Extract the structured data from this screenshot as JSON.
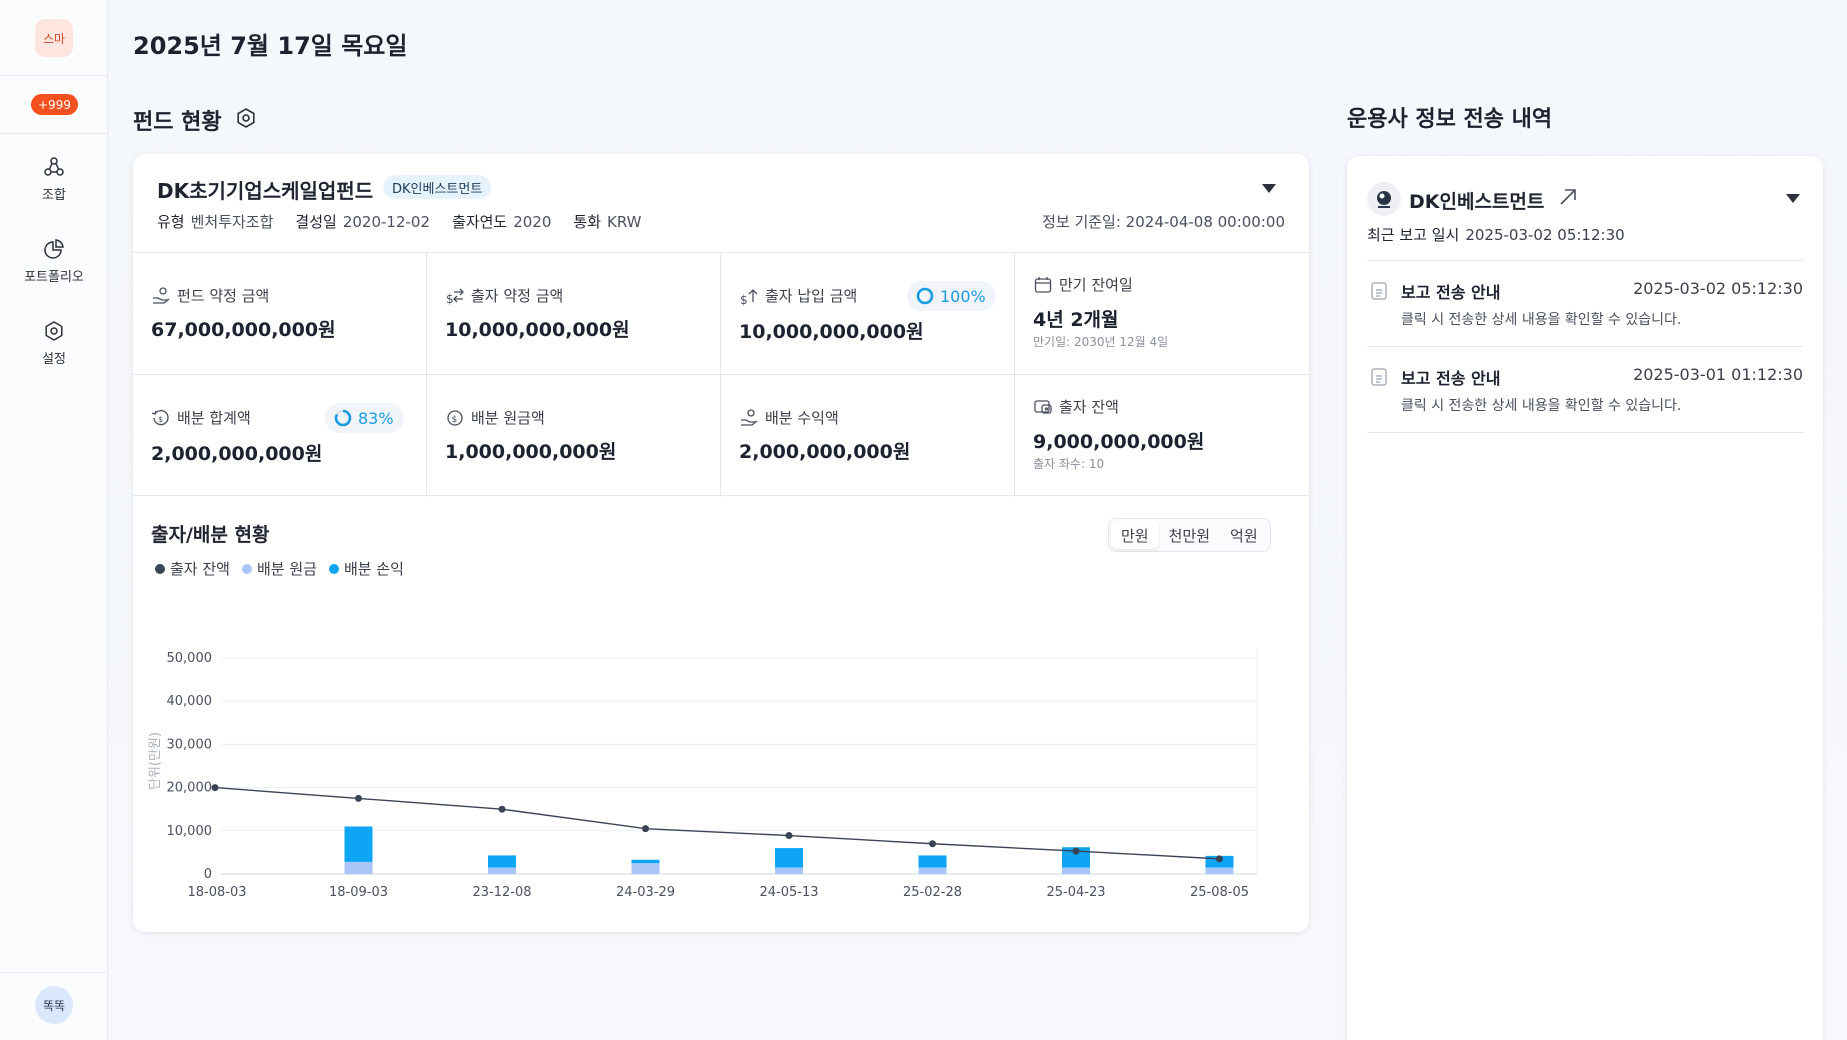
{
  "sidebar": {
    "logo_text": "스마",
    "badge": "+999",
    "items": [
      {
        "label": "조합",
        "icon": "cluster-icon"
      },
      {
        "label": "포트폴리오",
        "icon": "pie-chart-icon"
      },
      {
        "label": "설정",
        "icon": "gear-icon"
      }
    ],
    "bottom_avatar": "똑똑"
  },
  "header": {
    "date": "2025년 7월 17일 목요일"
  },
  "fund_section": {
    "title": "펀드 현황",
    "fund": {
      "name": "DK초기기업스케일업펀드",
      "manager_tag": "DK인베스트먼트",
      "meta": [
        {
          "key": "유형",
          "value": "벤처투자조합"
        },
        {
          "key": "결성일",
          "value": "2020-12-02"
        },
        {
          "key": "출자연도",
          "value": "2020"
        },
        {
          "key": "통화",
          "value": "KRW"
        }
      ],
      "info_date": "정보 기준일: 2024-04-08 00:00:00"
    },
    "metrics": {
      "commitment_total": {
        "label": "펀드 약정 금액",
        "value": "67,000,000,000원"
      },
      "lp_commitment": {
        "label": "출자 약정 금액",
        "value": "10,000,000,000원"
      },
      "paid_in": {
        "label": "출자 납입 금액",
        "value": "10,000,000,000원",
        "percent": "100%",
        "ratio": 1.0
      },
      "maturity": {
        "label": "만기 잔여일",
        "value": "4년 2개월",
        "sub": "만기일: 2030년 12월 4일"
      },
      "distribution_total": {
        "label": "배분 합계액",
        "value": "2,000,000,000원",
        "percent": "83%",
        "ratio": 0.83
      },
      "distribution_principal": {
        "label": "배분 원금액",
        "value": "1,000,000,000원"
      },
      "distribution_profit": {
        "label": "배분 수익액",
        "value": "2,000,000,000원"
      },
      "balance": {
        "label": "출자 잔액",
        "value": "9,000,000,000원",
        "sub": "출자 좌수: 10"
      }
    },
    "chart_title": "출자/배분 현황",
    "units": [
      "만원",
      "천만원",
      "억원"
    ],
    "active_unit": "만원"
  },
  "colors": {
    "balance": "#3b4456",
    "principal": "#a9c5f7",
    "profit": "#0ea5f5",
    "accent": "#1a9ce3"
  },
  "chart_data": {
    "type": "bar",
    "categories": [
      "18-08-03",
      "18-09-03",
      "23-12-08",
      "24-03-29",
      "24-05-13",
      "25-02-28",
      "25-04-23",
      "25-08-05"
    ],
    "ylabel": "단위(만원)",
    "ylim": [
      0,
      50000
    ],
    "yticks": [
      0,
      10000,
      20000,
      30000,
      40000,
      50000
    ],
    "ytick_labels": [
      "0",
      "10,000",
      "20,000",
      "30,000",
      "40,000",
      "50,000"
    ],
    "grid": true,
    "legend_position": "top-left",
    "series": [
      {
        "name": "출자 잔액",
        "kind": "line",
        "values": [
          20000,
          17500,
          15000,
          10500,
          8900,
          7000,
          5300,
          3500
        ]
      },
      {
        "name": "배분 원금",
        "kind": "bar",
        "values": [
          null,
          2800,
          1500,
          2500,
          1500,
          1500,
          1500,
          1500
        ]
      },
      {
        "name": "배분 손익",
        "kind": "bar",
        "values": [
          null,
          8200,
          2800,
          800,
          4500,
          2800,
          4700,
          2700
        ]
      }
    ]
  },
  "report_section": {
    "title": "운용사 정보 전송 내역",
    "manager_name": "DK인베스트먼트",
    "last_report_label": "최근 보고 일시",
    "last_report_time": "2025-03-02 05:12:30",
    "items": [
      {
        "title": "보고 전송 안내",
        "date": "2025-03-02 05:12:30",
        "desc": "클릭 시 전송한 상세 내용을 확인할 수 있습니다."
      },
      {
        "title": "보고 전송 안내",
        "date": "2025-03-01 01:12:30",
        "desc": "클릭 시 전송한 상세 내용을 확인할 수 있습니다."
      }
    ]
  }
}
